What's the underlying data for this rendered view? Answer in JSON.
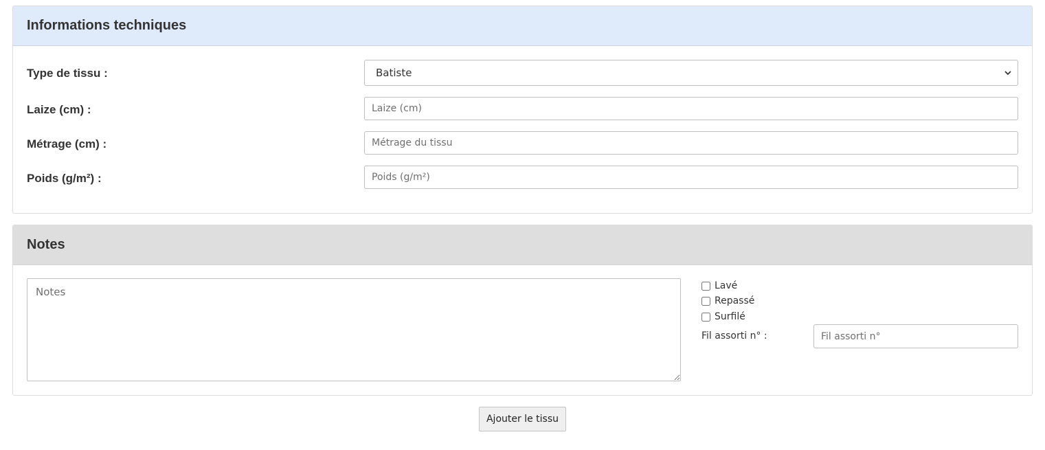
{
  "tech": {
    "heading": "Informations techniques",
    "type_label": "Type de tissu :",
    "type_selected": "Batiste",
    "laize_label": "Laize (cm) :",
    "laize_placeholder": "Laize (cm)",
    "metrage_label": "Métrage (cm) :",
    "metrage_placeholder": "Métrage du tissu",
    "poids_label": "Poids (g/m²) :",
    "poids_placeholder": "Poids (g/m²)"
  },
  "notes": {
    "heading": "Notes",
    "textarea_placeholder": "Notes",
    "checks": {
      "lave": "Lavé",
      "repasse": "Repassé",
      "surfile": "Surfilé"
    },
    "fil_label": "Fil assorti n° :",
    "fil_placeholder": "Fil assorti n°"
  },
  "actions": {
    "submit_label": "Ajouter le tissu"
  },
  "colors": {
    "tech_heading_bg": "#dfeafa",
    "notes_heading_bg": "#dedede"
  }
}
